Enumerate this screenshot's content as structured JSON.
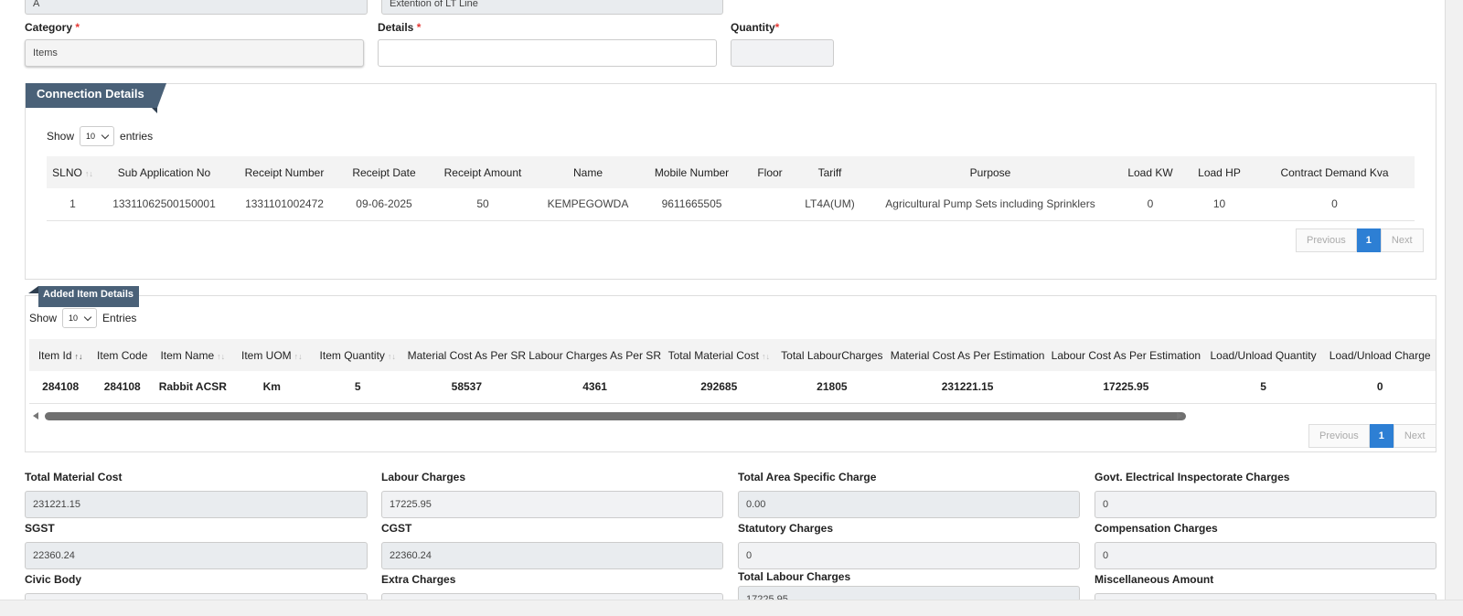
{
  "top_fields": {
    "field_a_value": "A",
    "field_b_value": "Extention of LT Line"
  },
  "form": {
    "category_label": "Category",
    "category_value": "Items",
    "details_label": "Details",
    "details_value": "",
    "quantity_label": "Quantity",
    "quantity_value": "",
    "required_mark": "*"
  },
  "connection": {
    "title": "Connection Details",
    "show_label": "Show",
    "entries_value": "10",
    "entries_label": "entries",
    "columns": [
      "SLNO",
      "Sub Application No",
      "Receipt Number",
      "Receipt Date",
      "Receipt Amount",
      "Name",
      "Mobile Number",
      "Floor",
      "Tariff",
      "Purpose",
      "Load KW",
      "Load HP",
      "Contract Demand Kva"
    ],
    "rows": [
      [
        "1",
        "13311062500150001",
        "1331101002472",
        "09-06-2025",
        "50",
        "KEMPEGOWDA",
        "9611665505",
        "",
        "LT4A(UM)",
        "Agricultural Pump Sets including Sprinklers",
        "0",
        "10",
        "0"
      ]
    ],
    "pagination": {
      "previous": "Previous",
      "page": "1",
      "next": "Next"
    }
  },
  "items": {
    "title": "Added Item Details",
    "show_label": "Show",
    "entries_value": "10",
    "entries_label": "Entries",
    "columns": [
      "Item Id",
      "Item Code",
      "Item Name",
      "Item UOM",
      "Item Quantity",
      "Material Cost As Per SR",
      "Labour Charges As Per SR",
      "Total Material Cost",
      "Total LabourCharges",
      "Material Cost As Per Estimation",
      "Labour Cost As Per Estimation",
      "Load/Unload Quantity",
      "Load/Unload Charge"
    ],
    "rows": [
      [
        "284108",
        "284108",
        "Rabbit ACSR",
        "Km",
        "5",
        "58537",
        "4361",
        "292685",
        "21805",
        "231221.15",
        "17225.95",
        "5",
        "0"
      ]
    ],
    "pagination": {
      "previous": "Previous",
      "page": "1",
      "next": "Next"
    }
  },
  "totals": {
    "total_material_cost": {
      "label": "Total Material Cost",
      "value": "231221.15"
    },
    "labour_charges": {
      "label": "Labour Charges",
      "value": "17225.95"
    },
    "total_area_specific_charge": {
      "label": "Total Area Specific Charge",
      "value": "0.00"
    },
    "govt_electrical_inspectorate_charges": {
      "label": "Govt. Electrical Inspectorate Charges",
      "value": "0"
    },
    "sgst": {
      "label": "SGST",
      "value": "22360.24"
    },
    "cgst": {
      "label": "CGST",
      "value": "22360.24"
    },
    "statutory_charges": {
      "label": "Statutory Charges",
      "value": "0"
    },
    "compensation_charges": {
      "label": "Compensation Charges",
      "value": "0"
    },
    "civic_body": {
      "label": "Civic Body",
      "value": ""
    },
    "extra_charges": {
      "label": "Extra Charges",
      "value": ""
    },
    "total_labour_charges": {
      "label": "Total Labour Charges",
      "value": "17225.95"
    },
    "miscellaneous_amount": {
      "label": "Miscellaneous Amount",
      "value": ""
    }
  }
}
